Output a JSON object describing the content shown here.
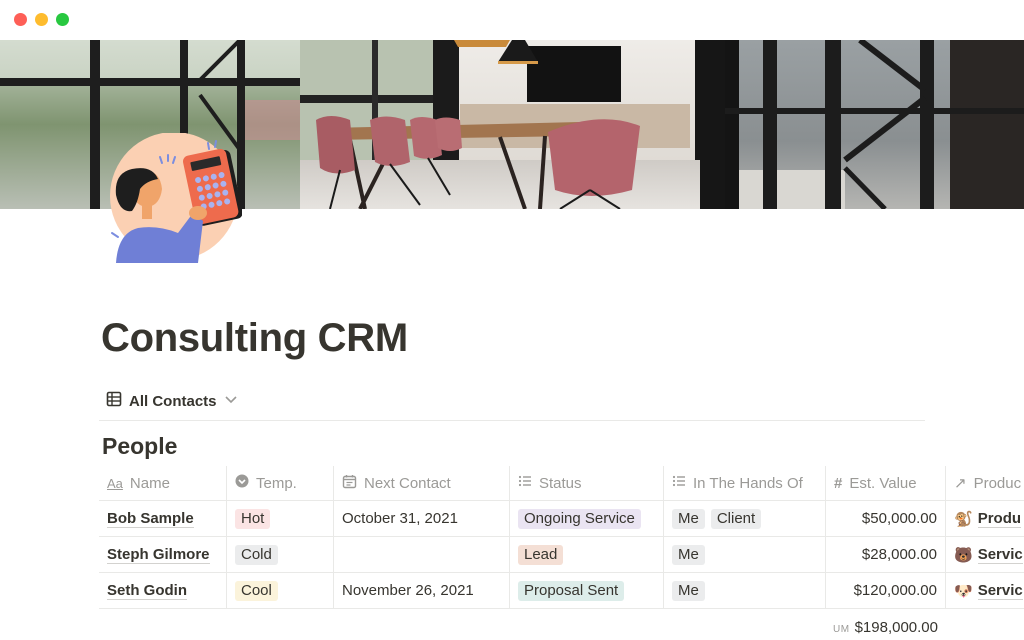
{
  "window": {
    "controls": [
      "close",
      "minimize",
      "maximize"
    ]
  },
  "cover": {
    "description": "Modern meeting room with wooden table, pink chairs, pendant lamps and large windows"
  },
  "page_icon": {
    "description": "Illustration of a person holding an orange calculator"
  },
  "page": {
    "title": "Consulting CRM"
  },
  "view": {
    "icon": "table-icon",
    "label": "All Contacts",
    "dropdown_icon": "chevron-down-icon"
  },
  "database": {
    "title": "People",
    "columns": [
      {
        "icon": "text-icon",
        "icon_glyph": "Aa",
        "label": "Name"
      },
      {
        "icon": "select-icon",
        "label": "Temp."
      },
      {
        "icon": "calendar-icon",
        "label": "Next Contact"
      },
      {
        "icon": "list-icon",
        "label": "Status"
      },
      {
        "icon": "list-icon",
        "label": "In The Hands Of"
      },
      {
        "icon": "number-icon",
        "icon_glyph": "#",
        "label": "Est. Value"
      },
      {
        "icon": "relation-arrow-icon",
        "icon_glyph": "↗",
        "label": "Produc"
      }
    ],
    "rows": [
      {
        "name": "Bob Sample",
        "temp": {
          "label": "Hot",
          "color": "#fbe4e4"
        },
        "next_contact": "October 31, 2021",
        "status": {
          "label": "Ongoing Service",
          "color": "#eae4f2"
        },
        "hands": [
          "Me",
          "Client"
        ],
        "est_value": "$50,000.00",
        "product": {
          "emoji": "🐒",
          "label": "Produ"
        }
      },
      {
        "name": "Steph Gilmore",
        "temp": {
          "label": "Cold",
          "color": "#ebeced"
        },
        "next_contact": "",
        "status": {
          "label": "Lead",
          "color": "#f4dfd5"
        },
        "hands": [
          "Me"
        ],
        "est_value": "$28,000.00",
        "product": {
          "emoji": "🐻",
          "label": "Servic"
        }
      },
      {
        "name": "Seth Godin",
        "temp": {
          "label": "Cool",
          "color": "#fbf3db"
        },
        "next_contact": "November 26, 2021",
        "status": {
          "label": "Proposal Sent",
          "color": "#ddedea"
        },
        "hands": [
          "Me"
        ],
        "est_value": "$120,000.00",
        "product": {
          "emoji": "🐶",
          "label": "Servic"
        }
      }
    ],
    "summary": {
      "label": "UM",
      "value": "$198,000.00"
    }
  },
  "colors": {
    "text": "#37352f",
    "muted": "#9b9a97",
    "border": "#e9e9e7",
    "hands_tag": "#ebeced"
  }
}
